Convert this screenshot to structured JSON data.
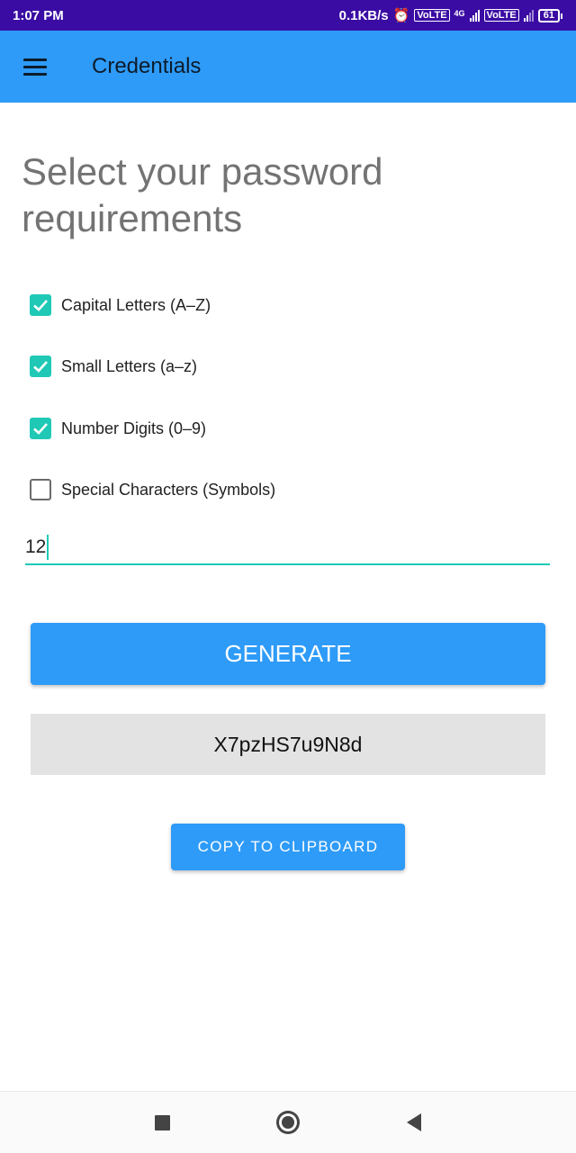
{
  "status_bar": {
    "time": "1:07 PM",
    "network_speed": "0.1KB/s",
    "alarm_icon": "alarm-icon",
    "volte_label": "Vo LTE",
    "network_type": "4G",
    "battery_level": "61"
  },
  "app_bar": {
    "menu_icon": "hamburger-menu-icon",
    "title": "Credentials"
  },
  "heading": "Select your password requirements",
  "options": [
    {
      "label": "Capital Letters (A–Z)",
      "checked": true
    },
    {
      "label": "Small Letters (a–z)",
      "checked": true
    },
    {
      "label": "Number Digits (0–9)",
      "checked": true
    },
    {
      "label": "Special Characters (Symbols)",
      "checked": false
    }
  ],
  "length_input": {
    "value": "12"
  },
  "generate_button": {
    "label": "GENERATE"
  },
  "generated_password": "X7pzHS7u9N8d",
  "copy_button": {
    "label": "COPY TO CLIPBOARD"
  },
  "nav_bar": {
    "recents_icon": "square-recents-icon",
    "home_icon": "circle-home-icon",
    "back_icon": "triangle-back-icon"
  },
  "colors": {
    "status_bar": "#3a0ca3",
    "primary": "#2e9bf8",
    "accent": "#1fc9b6",
    "heading_text": "#737373",
    "password_bg": "#e3e3e3"
  }
}
